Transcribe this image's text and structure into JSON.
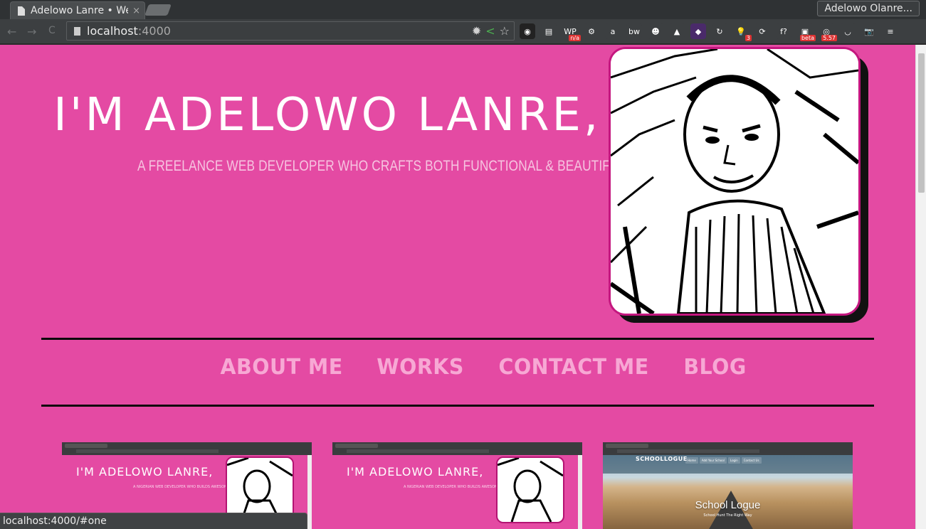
{
  "browser": {
    "tab_title": "Adelowo Lanre • We",
    "tab_close": "×",
    "profile_name": "Adelowo Olanre...",
    "url_host": "localhost",
    "url_port": ":4000",
    "back": "←",
    "forward": "→",
    "reload": "C",
    "extensions": [
      {
        "name": "chrome-color-icon",
        "label": "◉",
        "color": "#222"
      },
      {
        "name": "print-icon",
        "label": "▤",
        "color": "#3c3f41"
      },
      {
        "name": "wp-icon",
        "label": "WP",
        "color": "#3c3f41",
        "badge": "n/a"
      },
      {
        "name": "gear-icon",
        "label": "⚙",
        "color": "#3c3f41"
      },
      {
        "name": "amazon-icon",
        "label": "a",
        "color": "#3c3f41"
      },
      {
        "name": "bw-icon",
        "label": "bw",
        "color": "#3c3f41"
      },
      {
        "name": "face-icon",
        "label": "☻",
        "color": "#3c3f41"
      },
      {
        "name": "analytics-icon",
        "label": "▲",
        "color": "#3c3f41"
      },
      {
        "name": "purple-square-icon",
        "label": "◆",
        "color": "#4a2a6a"
      },
      {
        "name": "refresh-ext-icon",
        "label": "↻",
        "color": "#3c3f41"
      },
      {
        "name": "bulb-icon",
        "label": "💡",
        "color": "#3c3f41",
        "badge": "3"
      },
      {
        "name": "sync-icon",
        "label": "⟳",
        "color": "#3c3f41"
      },
      {
        "name": "function-icon",
        "label": "f?",
        "color": "#3c3f41"
      },
      {
        "name": "beta-icon",
        "label": "▣",
        "color": "#3c3f41",
        "badge": "beta"
      },
      {
        "name": "counter-icon",
        "label": "◎",
        "color": "#3c3f41",
        "badge": "5.57"
      },
      {
        "name": "pocket-icon",
        "label": "◡",
        "color": "#3c3f41"
      },
      {
        "name": "camera-icon",
        "label": "📷",
        "color": "#3c3f41"
      },
      {
        "name": "menu-icon",
        "label": "≡",
        "color": "#3c3f41"
      }
    ]
  },
  "hero": {
    "title": "I'M ADELOWO LANRE,",
    "subtitle": "A FREELANCE WEB DEVELOPER WHO CRAFTS BOTH FUNCTIONAL & BEAUTIFUL WEBSITES"
  },
  "nav": {
    "items": [
      "ABOUT ME",
      "WORKS",
      "CONTACT ME",
      "BLOG"
    ]
  },
  "works": {
    "mini_title": "I'M ADELOWO LANRE,",
    "mini_subtitle": "A NIGERIAN WEB DEVELOPER WHO BUILDS AWESOME STUFFS",
    "school_logo": "SCHOOLLOGUE",
    "school_nav": [
      "Home",
      "Add Your School",
      "Login",
      "Contact Us"
    ],
    "school_title": "School Logue",
    "school_tagline": "School Hunt The Right Way"
  },
  "status": {
    "link_url": "localhost:4000/#one"
  },
  "colors": {
    "page_bg": "#e44aa3",
    "nav_text": "#f7a8d4",
    "subtitle_text": "#f6c4e0"
  }
}
